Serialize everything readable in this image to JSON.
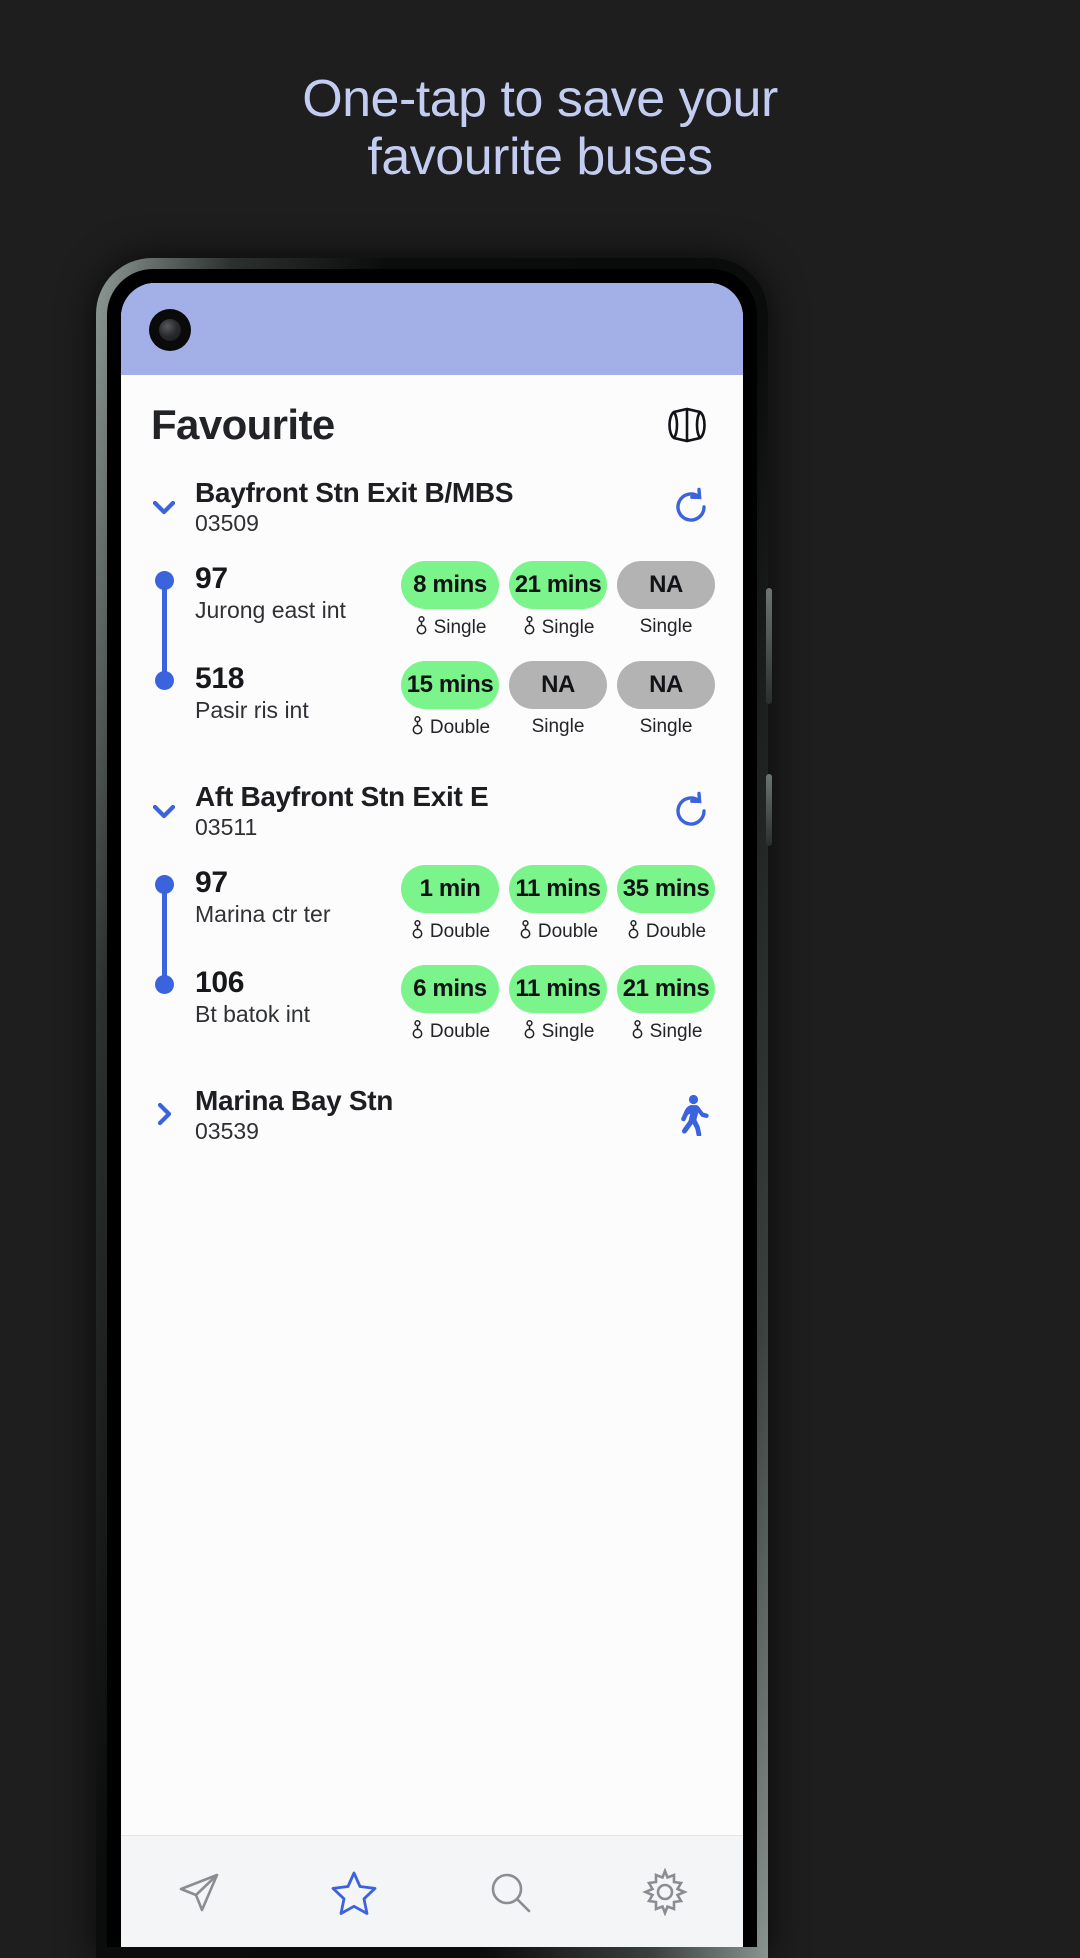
{
  "promo": {
    "line1": "One-tap to save your",
    "line2": "favourite buses"
  },
  "colors": {
    "background": "#1e1e1e",
    "promo_text": "#c3cdf2",
    "status_bar": "#a3b0e8",
    "accent_blue": "#3a63dd",
    "pill_green": "#7cf48c",
    "pill_na": "#b3b3b3",
    "screen_bg": "#fcfcfd"
  },
  "appbar": {
    "title": "Favourite",
    "mask_icon": "mask-icon"
  },
  "stops": [
    {
      "name": "Bayfront Stn Exit B/MBS",
      "code": "03509",
      "expanded": true,
      "chevron_icon": "chevron-down-icon",
      "action_icon": "refresh-icon",
      "buses": [
        {
          "number": "97",
          "destination": "Jurong east int",
          "arrivals": [
            {
              "time": "8 mins",
              "status": "available",
              "deck": "Single",
              "deck_icon": "bus-deck-icon"
            },
            {
              "time": "21 mins",
              "status": "available",
              "deck": "Single",
              "deck_icon": "bus-deck-icon"
            },
            {
              "time": "NA",
              "status": "unavailable",
              "deck": "Single",
              "deck_icon": ""
            }
          ]
        },
        {
          "number": "518",
          "destination": "Pasir ris int",
          "arrivals": [
            {
              "time": "15 mins",
              "status": "available",
              "deck": "Double",
              "deck_icon": "bus-deck-icon"
            },
            {
              "time": "NA",
              "status": "unavailable",
              "deck": "Single",
              "deck_icon": ""
            },
            {
              "time": "NA",
              "status": "unavailable",
              "deck": "Single",
              "deck_icon": ""
            }
          ]
        }
      ]
    },
    {
      "name": "Aft Bayfront Stn Exit E",
      "code": "03511",
      "expanded": true,
      "chevron_icon": "chevron-down-icon",
      "action_icon": "refresh-icon",
      "buses": [
        {
          "number": "97",
          "destination": "Marina ctr ter",
          "arrivals": [
            {
              "time": "1 min",
              "status": "available",
              "deck": "Double",
              "deck_icon": "bus-deck-icon"
            },
            {
              "time": "11 mins",
              "status": "available",
              "deck": "Double",
              "deck_icon": "bus-deck-icon"
            },
            {
              "time": "35 mins",
              "status": "available",
              "deck": "Double",
              "deck_icon": "bus-deck-icon"
            }
          ]
        },
        {
          "number": "106",
          "destination": "Bt batok int",
          "arrivals": [
            {
              "time": "6 mins",
              "status": "available",
              "deck": "Double",
              "deck_icon": "bus-deck-icon"
            },
            {
              "time": "11 mins",
              "status": "available",
              "deck": "Single",
              "deck_icon": "bus-deck-icon"
            },
            {
              "time": "21 mins",
              "status": "available",
              "deck": "Single",
              "deck_icon": "bus-deck-icon"
            }
          ]
        }
      ]
    },
    {
      "name": "Marina Bay Stn",
      "code": "03539",
      "expanded": false,
      "chevron_icon": "chevron-right-icon",
      "action_icon": "walking-person-icon",
      "buses": []
    }
  ],
  "bottom_nav": [
    {
      "icon": "send-icon",
      "active": false
    },
    {
      "icon": "star-icon",
      "active": true
    },
    {
      "icon": "search-icon",
      "active": false
    },
    {
      "icon": "gear-icon",
      "active": false
    }
  ]
}
